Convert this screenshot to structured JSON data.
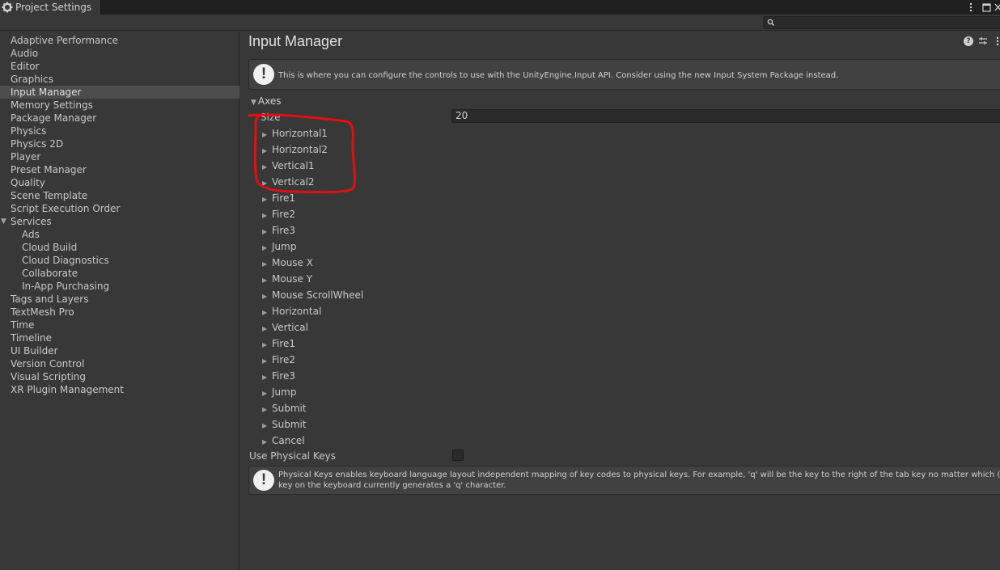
{
  "window": {
    "tab_title": "Project Settings",
    "tab_icon": "gear-icon",
    "controls": [
      "more-icon",
      "maximize-icon",
      "close-icon"
    ]
  },
  "search": {
    "value": "",
    "placeholder": ""
  },
  "sidebar": {
    "items": [
      {
        "label": "Adaptive Performance"
      },
      {
        "label": "Audio"
      },
      {
        "label": "Editor"
      },
      {
        "label": "Graphics"
      },
      {
        "label": "Input Manager"
      },
      {
        "label": "Memory Settings"
      },
      {
        "label": "Package Manager"
      },
      {
        "label": "Physics"
      },
      {
        "label": "Physics 2D"
      },
      {
        "label": "Player"
      },
      {
        "label": "Preset Manager"
      },
      {
        "label": "Quality"
      },
      {
        "label": "Scene Template"
      },
      {
        "label": "Script Execution Order"
      },
      {
        "label": "Services"
      },
      {
        "label": "Ads"
      },
      {
        "label": "Cloud Build"
      },
      {
        "label": "Cloud Diagnostics"
      },
      {
        "label": "Collaborate"
      },
      {
        "label": "In-App Purchasing"
      },
      {
        "label": "Tags and Layers"
      },
      {
        "label": "TextMesh Pro"
      },
      {
        "label": "Time"
      },
      {
        "label": "Timeline"
      },
      {
        "label": "UI Builder"
      },
      {
        "label": "Version Control"
      },
      {
        "label": "Visual Scripting"
      },
      {
        "label": "XR Plugin Management"
      }
    ],
    "selected": "Input Manager"
  },
  "main": {
    "title": "Input Manager",
    "info_message": "This is where you can configure the controls to use with the UnityEngine.Input API. Consider using the new Input System Package instead.",
    "axes_label": "Axes",
    "size_label": "Size",
    "size_value": "20",
    "axes": [
      {
        "label": "Horizontal1"
      },
      {
        "label": "Horizontal2"
      },
      {
        "label": "Vertical1"
      },
      {
        "label": "Vertical2"
      },
      {
        "label": "Fire1"
      },
      {
        "label": "Fire2"
      },
      {
        "label": "Fire3"
      },
      {
        "label": "Jump"
      },
      {
        "label": "Mouse X"
      },
      {
        "label": "Mouse Y"
      },
      {
        "label": "Mouse ScrollWheel"
      },
      {
        "label": "Horizontal"
      },
      {
        "label": "Vertical"
      },
      {
        "label": "Fire1"
      },
      {
        "label": "Fire2"
      },
      {
        "label": "Fire3"
      },
      {
        "label": "Jump"
      },
      {
        "label": "Submit"
      },
      {
        "label": "Submit"
      },
      {
        "label": "Cancel"
      }
    ],
    "physical_keys_label": "Use Physical Keys",
    "physical_keys_checked": false,
    "physical_keys_message_line1": "Physical Keys enables keyboard language layout independent mapping of key codes to physical keys. For example, 'q' will be the key to the right of the tab key no matter which (if any)",
    "physical_keys_message_line2": "key on the keyboard currently generates a 'q' character."
  },
  "colors": {
    "background": "#383838",
    "tabbar": "#1f1f1f",
    "selected_item": "#4d4d4d",
    "annotation": "#e01010"
  }
}
